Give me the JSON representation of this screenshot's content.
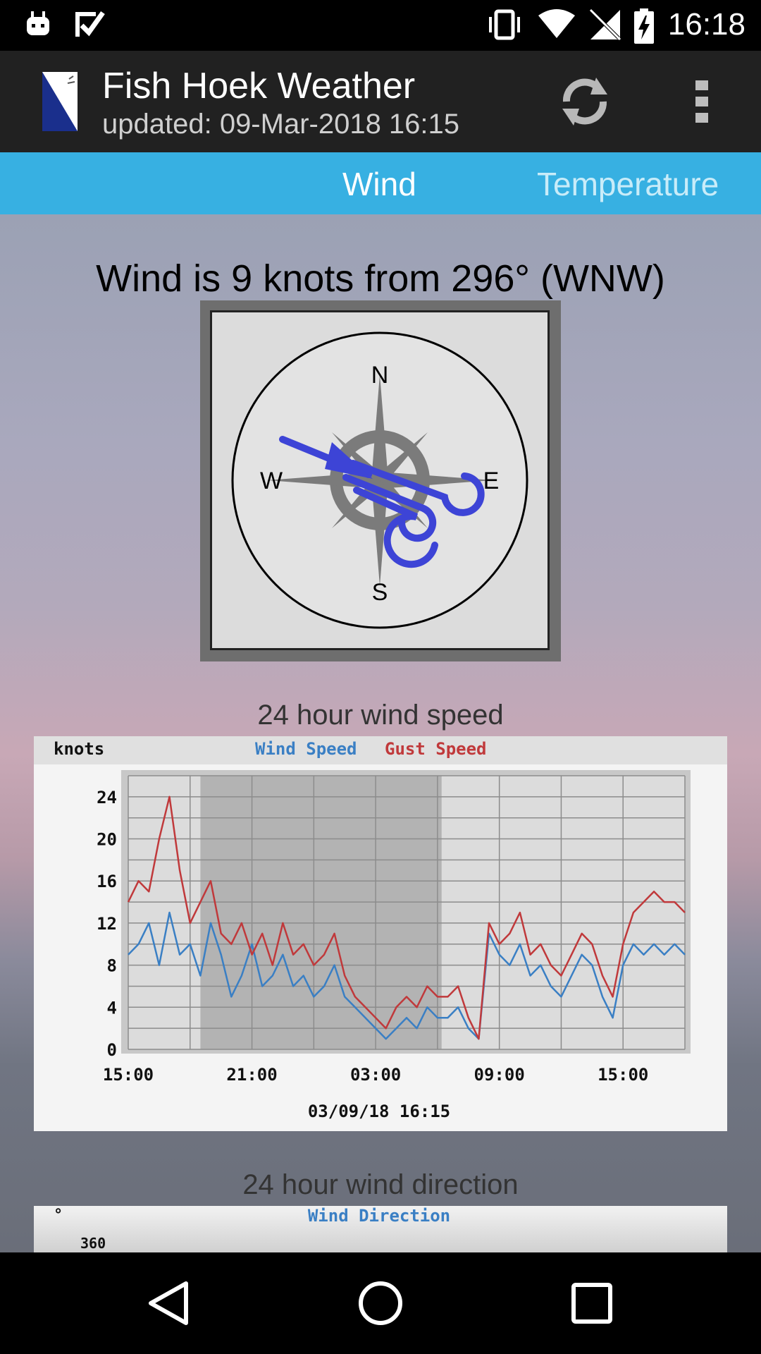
{
  "status_bar": {
    "time": "16:18",
    "left_icons": [
      "android-notification-icon",
      "checklist-notification-icon"
    ],
    "right_icons": [
      "vibrate-icon",
      "wifi-icon",
      "no-signal-icon",
      "battery-charging-icon"
    ]
  },
  "app_bar": {
    "title": "Fish Hoek Weather",
    "subtitle": "updated: 09-Mar-2018 16:15",
    "actions": [
      "refresh-icon",
      "overflow-menu-icon"
    ]
  },
  "tabs": [
    {
      "label": "Wind",
      "selected": true
    },
    {
      "label": "Temperature",
      "selected": false
    }
  ],
  "wind": {
    "headline": "Wind is 9 knots from 296° (WNW)",
    "speed_knots": 9,
    "direction_degrees": 296,
    "direction_label": "WNW",
    "compass": {
      "n": "N",
      "e": "E",
      "s": "S",
      "w": "W"
    }
  },
  "speed_section": {
    "caption": "24 hour wind speed"
  },
  "direction_section": {
    "caption": "24 hour wind direction",
    "chart_title": "Wind Direction",
    "unit_label": "°",
    "partial_tick": "360"
  },
  "colors": {
    "app_bar": "#212121",
    "tab_bar": "#37b0e2",
    "wind_speed": "#3a7fc4",
    "gust_speed": "#c0393b",
    "compass_arrow": "#3d44d6",
    "night_shade": "#b3b3b3"
  },
  "nav_bar": {
    "buttons": [
      "back-icon",
      "home-icon",
      "recents-icon"
    ]
  },
  "chart_data": {
    "type": "line",
    "unit_label": "knots",
    "footer": "03/09/18 16:15",
    "x_ticks": [
      "15:00",
      "21:00",
      "03:00",
      "09:00",
      "15:00"
    ],
    "y_ticks": [
      0,
      4,
      8,
      12,
      16,
      20,
      24
    ],
    "ylim": [
      0,
      26
    ],
    "grid": true,
    "legend": "top-center",
    "night_shading_hours": [
      3.5,
      15.2
    ],
    "x_hours": [
      0,
      0.5,
      1,
      1.5,
      2,
      2.5,
      3,
      3.5,
      4,
      4.5,
      5,
      5.5,
      6,
      6.5,
      7,
      7.5,
      8,
      8.5,
      9,
      9.5,
      10,
      10.5,
      11,
      11.5,
      12,
      12.5,
      13,
      13.5,
      14,
      14.5,
      15,
      15.5,
      16,
      16.5,
      17,
      17.5,
      18,
      18.5,
      19,
      19.5,
      20,
      20.5,
      21,
      21.5,
      22,
      22.5,
      23,
      23.5,
      24,
      24.5,
      25,
      25.5,
      26,
      26.5,
      27
    ],
    "series": [
      {
        "name": "Wind Speed",
        "color": "#3a7fc4",
        "values": [
          9,
          10,
          12,
          8,
          13,
          9,
          10,
          7,
          12,
          9,
          5,
          7,
          10,
          6,
          7,
          9,
          6,
          7,
          5,
          6,
          8,
          5,
          4,
          3,
          2,
          1,
          2,
          3,
          2,
          4,
          3,
          3,
          4,
          2,
          1,
          11,
          9,
          8,
          10,
          7,
          8,
          6,
          5,
          7,
          9,
          8,
          5,
          3,
          8,
          10,
          9,
          10,
          9,
          10,
          9
        ]
      },
      {
        "name": "Gust Speed",
        "color": "#c0393b",
        "values": [
          14,
          16,
          15,
          20,
          24,
          17,
          12,
          14,
          16,
          11,
          10,
          12,
          9,
          11,
          8,
          12,
          9,
          10,
          8,
          9,
          11,
          7,
          5,
          4,
          3,
          2,
          4,
          5,
          4,
          6,
          5,
          5,
          6,
          3,
          1,
          12,
          10,
          11,
          13,
          9,
          10,
          8,
          7,
          9,
          11,
          10,
          7,
          5,
          10,
          13,
          14,
          15,
          14,
          14,
          13
        ]
      }
    ]
  }
}
